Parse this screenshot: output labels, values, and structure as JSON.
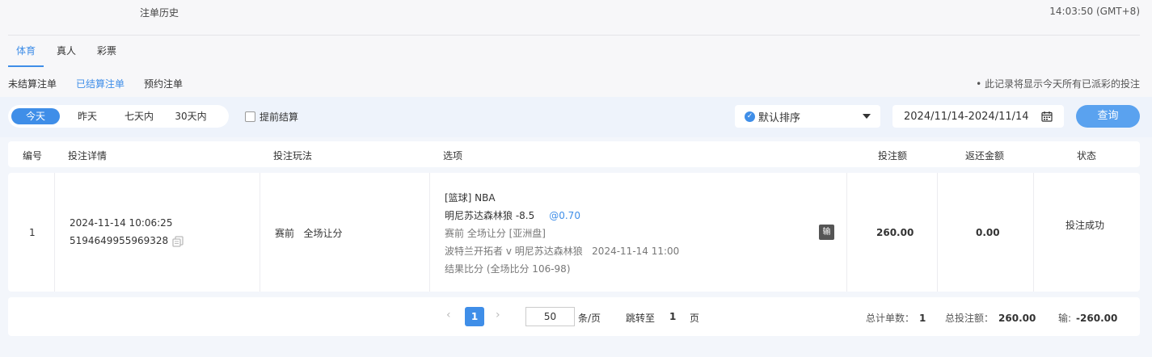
{
  "header": {
    "title": "注单历史",
    "clock": "14:03:50 (GMT+8)"
  },
  "tabs": [
    {
      "label": "体育"
    },
    {
      "label": "真人"
    },
    {
      "label": "彩票"
    }
  ],
  "subtabs": [
    {
      "label": "未结算注单"
    },
    {
      "label": "已结算注单"
    },
    {
      "label": "预约注单"
    }
  ],
  "notice": "• 此记录将显示今天所有已派彩的投注",
  "filter": {
    "ranges": [
      {
        "label": "今天"
      },
      {
        "label": "昨天"
      },
      {
        "label": "七天内"
      },
      {
        "label": "30天内"
      }
    ],
    "early_settle": "提前结算",
    "sort": "默认排序",
    "date_range": "2024/11/14-2024/11/14",
    "query": "查询"
  },
  "table": {
    "headers": {
      "no": "编号",
      "detail": "投注详情",
      "play": "投注玩法",
      "option": "选项",
      "amount": "投注额",
      "refund": "返还金额",
      "status": "状态"
    },
    "rows": [
      {
        "no": "1",
        "datetime": "2024-11-14 10:06:25",
        "bet_id": "5194649955969328",
        "play": "赛前   全场让分",
        "sport": "[篮球] NBA",
        "pick": "明尼苏达森林狼 -8.5",
        "odds": "@0.70",
        "market": "赛前 全场让分 [亚洲盘]",
        "match": "波特兰开拓者 v 明尼苏达森林狼   2024-11-14 11:00",
        "result": "结果比分 (全场比分 106-98)",
        "outcome": "输",
        "amount": "260.00",
        "refund": "0.00",
        "status": "投注成功"
      }
    ]
  },
  "pager": {
    "current": "1",
    "page_size": "50",
    "per_page_label": "条/页",
    "jump_label": "跳转至",
    "jump_value": "1",
    "page_label": "页",
    "total_count_label": "总计单数：",
    "total_count": "1",
    "total_bet_label": "总投注额：",
    "total_bet": "260.00",
    "lose_label": "输:",
    "lose_value": "-260.00"
  },
  "colors": {
    "accent": "#3f8ee8",
    "query_button": "#5aa2ef"
  }
}
